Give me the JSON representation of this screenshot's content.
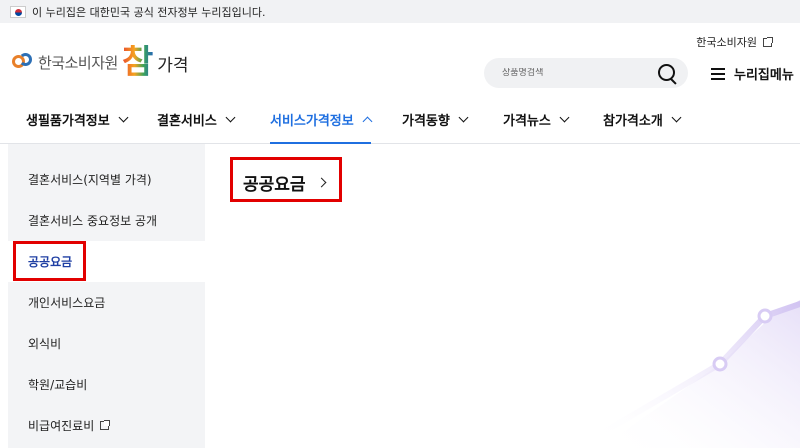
{
  "gov_banner": {
    "text": "이 누리집은 대한민국 공식 전자정부 누리집입니다."
  },
  "header": {
    "org_name": "한국소비자원",
    "brand_big": "참",
    "brand_small": "가격",
    "util_link": "한국소비자원",
    "search": {
      "placeholder": "상품명검색",
      "value": ""
    },
    "menu_label": "누리집메뉴"
  },
  "gnb": {
    "items": [
      {
        "label": "생필품가격정보",
        "expanded": false
      },
      {
        "label": "결혼서비스",
        "expanded": false
      },
      {
        "label": "서비스가격정보",
        "expanded": true
      },
      {
        "label": "가격동향",
        "expanded": false
      },
      {
        "label": "가격뉴스",
        "expanded": false
      },
      {
        "label": "참가격소개",
        "expanded": false
      }
    ]
  },
  "sidebar": {
    "items": [
      {
        "label": "결혼서비스(지역별 가격)"
      },
      {
        "label": "결혼서비스 중요정보 공개"
      },
      {
        "label": "공공요금",
        "active": true
      },
      {
        "label": "개인서비스요금"
      },
      {
        "label": "외식비"
      },
      {
        "label": "학원/교습비"
      },
      {
        "label": "비급여진료비",
        "external": true
      }
    ]
  },
  "content": {
    "title": "공공요금"
  },
  "colors": {
    "accent": "#1f6fe0",
    "active_side": "#1f3fa3",
    "highlight_border": "#e20000",
    "sidebar_bg": "#f3f4f6"
  }
}
